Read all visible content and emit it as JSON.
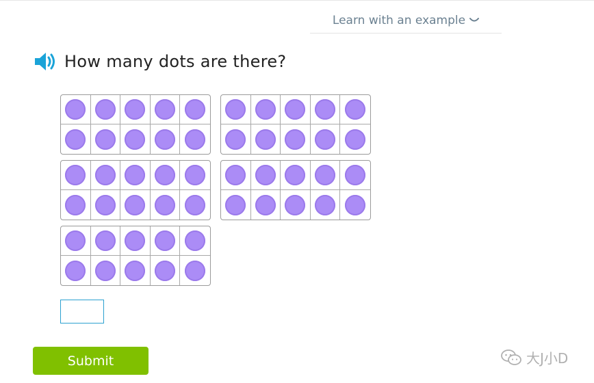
{
  "header": {
    "learn_link_label": "Learn with an example"
  },
  "question": {
    "text": "How many dots are there?",
    "speaker_icon": "speaker-icon"
  },
  "ten_frames": {
    "frame_count": 5,
    "cells_per_frame": 10,
    "filled_per_frame": 10,
    "dot_color": "#ab8cf6"
  },
  "answer": {
    "value": "",
    "placeholder": ""
  },
  "submit": {
    "label": "Submit",
    "color": "#80c000"
  },
  "watermark": {
    "text": "大J小D",
    "icon": "wechat-icon"
  }
}
